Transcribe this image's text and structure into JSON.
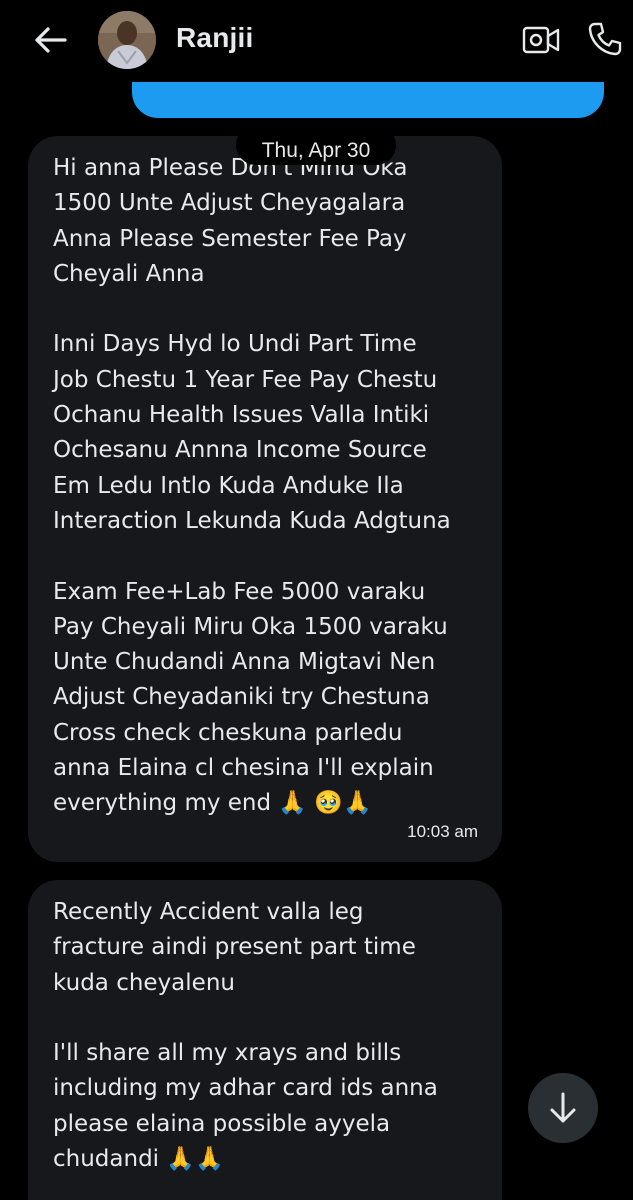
{
  "header": {
    "contact_name": "Ranjii",
    "back_icon": "arrow-left-icon",
    "video_icon": "video-camera-icon",
    "call_icon": "phone-icon"
  },
  "sent_message": {
    "color": "#1d9bf0"
  },
  "date_divider": "Thu, Apr 30",
  "messages": [
    {
      "text": "Hi anna Please Don't Mind Oka\n1500 Unte Adjust Cheyagalara\nAnna Please Semester Fee Pay\nCheyali Anna\n\nInni Days Hyd lo Undi Part Time\nJob Chestu 1 Year Fee Pay Chestu\nOchanu Health Issues Valla Intiki\nOchesanu Annna Income Source\nEm Ledu Intlo Kuda Anduke Ila\nInteraction Lekunda Kuda Adgtuna\n\nExam Fee+Lab Fee 5000 varaku\nPay Cheyali Miru Oka 1500 varaku\nUnte Chudandi Anna Migtavi Nen\nAdjust Cheyadaniki try Chestuna\nCross check cheskuna parledu\nanna Elaina cl chesina I'll explain\neverything my end 🙏 🥹🙏",
      "time": "10:03 am"
    },
    {
      "text": "Recently Accident valla leg\nfracture aindi present part time\nkuda cheyalenu\n\nI'll share all my xrays and bills\nincluding my adhar card ids anna\nplease elaina possible ayyela\nchudandi 🙏🙏"
    }
  ],
  "scroll_button_icon": "arrow-down-icon"
}
